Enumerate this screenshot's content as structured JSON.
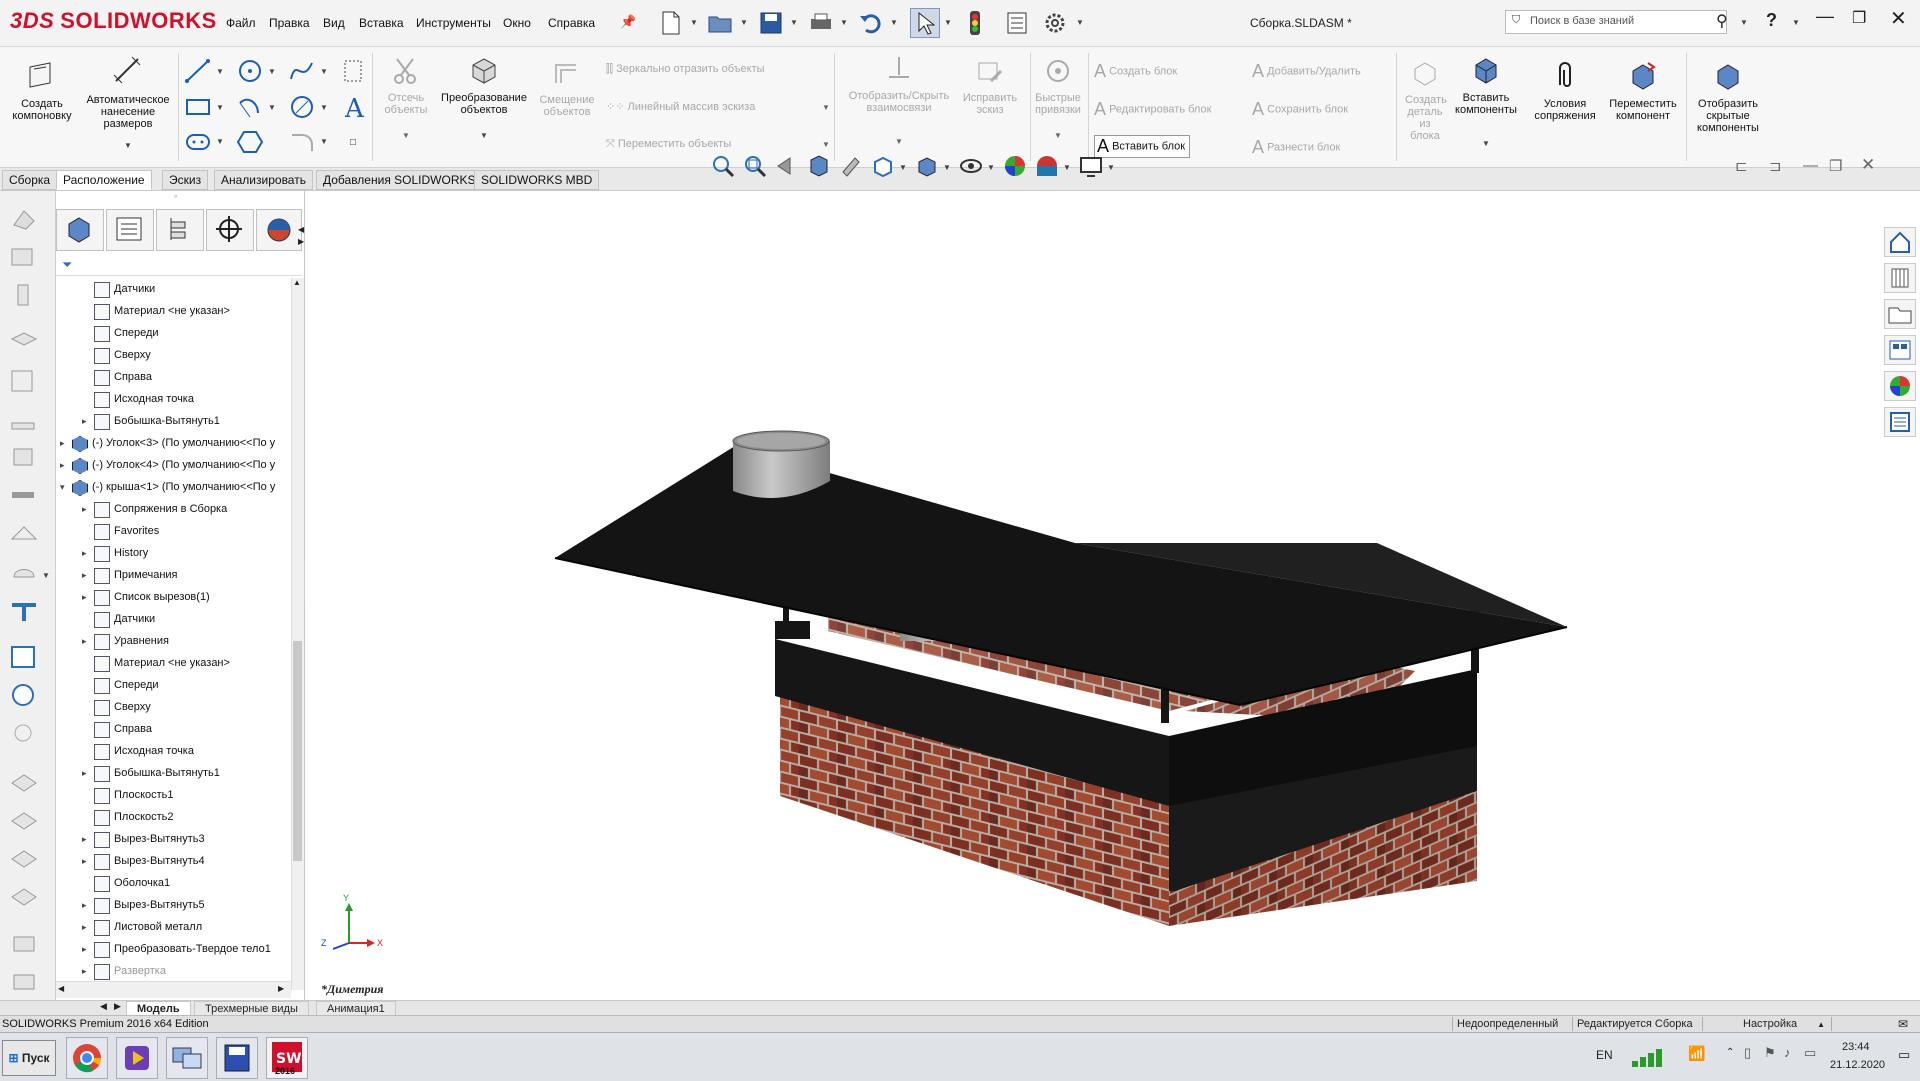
{
  "app": {
    "brand": "SOLIDWORKS",
    "brand_prefix": "3DS",
    "doc_title": "Сборка.SLDASM *"
  },
  "menu": [
    "Файл",
    "Правка",
    "Вид",
    "Вставка",
    "Инструменты",
    "Окно",
    "Справка"
  ],
  "search": {
    "placeholder": "Поиск в базе знаний"
  },
  "ribbon": {
    "create_layout": "Создать компоновку",
    "smart_dim": "Автоматическое нанесение размеров",
    "trim": "Отсечь объекты",
    "convert": "Преобразование объектов",
    "offset": "Смещение объектов",
    "mirror": "Зеркально отразить объекты",
    "linear_pattern": "Линейный массив эскиза",
    "move": "Переместить объекты",
    "show_hide_rel": "Отобразить/Скрыть взаимосвязи",
    "repair": "Исправить эскиз",
    "quick_snaps": "Быстрые привязки",
    "make_block": "Создать блок",
    "edit_block": "Редактировать блок",
    "insert_block": "Вставить блок",
    "add_remove": "Добавить/Удалить",
    "save_block": "Сохранить блок",
    "explode_block": "Разнести блок",
    "make_part": "Создать деталь из блока",
    "insert_components": "Вставить компоненты",
    "mate": "Условия сопряжения",
    "move_component": "Переместить компонент",
    "show_hidden": "Отобразить скрытые компоненты"
  },
  "cm_tabs": [
    "Сборка",
    "Расположение",
    "Эскиз",
    "Анализировать",
    "Добавления SOLIDWORKS",
    "SOLIDWORKS MBD"
  ],
  "cm_active": "Расположение",
  "tree": [
    {
      "label": "Датчики",
      "indent": 1,
      "arrow": false
    },
    {
      "label": "Материал <не указан>",
      "indent": 1,
      "arrow": false
    },
    {
      "label": "Спереди",
      "indent": 1,
      "arrow": false
    },
    {
      "label": "Сверху",
      "indent": 1,
      "arrow": false
    },
    {
      "label": "Справа",
      "indent": 1,
      "arrow": false
    },
    {
      "label": "Исходная точка",
      "indent": 1,
      "arrow": false
    },
    {
      "label": "Бобышка-Вытянуть1",
      "indent": 1,
      "arrow": true
    },
    {
      "label": "(-) Уголок<3> (По умолчанию<<По у",
      "indent": 0,
      "arrow": true
    },
    {
      "label": "(-) Уголок<4> (По умолчанию<<По у",
      "indent": 0,
      "arrow": true
    },
    {
      "label": "(-) крыша<1> (По умолчанию<<По у",
      "indent": 0,
      "arrow": true,
      "open": true
    },
    {
      "label": "Сопряжения в Сборка",
      "indent": 1,
      "arrow": true
    },
    {
      "label": "Favorites",
      "indent": 1,
      "arrow": false
    },
    {
      "label": "History",
      "indent": 1,
      "arrow": true
    },
    {
      "label": "Примечания",
      "indent": 1,
      "arrow": true
    },
    {
      "label": "Список вырезов(1)",
      "indent": 1,
      "arrow": true
    },
    {
      "label": "Датчики",
      "indent": 1,
      "arrow": false
    },
    {
      "label": "Уравнения",
      "indent": 1,
      "arrow": true
    },
    {
      "label": "Материал <не указан>",
      "indent": 1,
      "arrow": false
    },
    {
      "label": "Спереди",
      "indent": 1,
      "arrow": false
    },
    {
      "label": "Сверху",
      "indent": 1,
      "arrow": false
    },
    {
      "label": "Справа",
      "indent": 1,
      "arrow": false
    },
    {
      "label": "Исходная точка",
      "indent": 1,
      "arrow": false
    },
    {
      "label": "Бобышка-Вытянуть1",
      "indent": 1,
      "arrow": true
    },
    {
      "label": "Плоскость1",
      "indent": 1,
      "arrow": false
    },
    {
      "label": "Плоскость2",
      "indent": 1,
      "arrow": false
    },
    {
      "label": "Вырез-Вытянуть3",
      "indent": 1,
      "arrow": true
    },
    {
      "label": "Вырез-Вытянуть4",
      "indent": 1,
      "arrow": true
    },
    {
      "label": "Оболочка1",
      "indent": 1,
      "arrow": false
    },
    {
      "label": "Вырез-Вытянуть5",
      "indent": 1,
      "arrow": true
    },
    {
      "label": "Листовой металл",
      "indent": 1,
      "arrow": true
    },
    {
      "label": "Преобразовать-Твердое тело1",
      "indent": 1,
      "arrow": true
    },
    {
      "label": "Развертка",
      "indent": 1,
      "arrow": true,
      "dim": true
    }
  ],
  "viewport": {
    "view_name": "*Диметрия",
    "triad": {
      "x": "X",
      "y": "Y",
      "z": "Z"
    }
  },
  "bottom_tabs": [
    "Модель",
    "Трехмерные виды",
    "Анимация1"
  ],
  "bottom_active": "Модель",
  "status": {
    "edition": "SOLIDWORKS Premium 2016 x64 Edition",
    "state": "Недоопределенный",
    "editing": "Редактируется Сборка",
    "custom": "Настройка"
  },
  "taskbar": {
    "start": "Пуск",
    "lang": "EN",
    "time": "23:44",
    "date": "21.12.2020",
    "sw_badge": "2016"
  },
  "colors": {
    "brand": "#d0112b",
    "roof": "#111111",
    "brick": "#8a3a28",
    "mortar": "#b9b2a8",
    "pipe": "#a9a9a9"
  }
}
